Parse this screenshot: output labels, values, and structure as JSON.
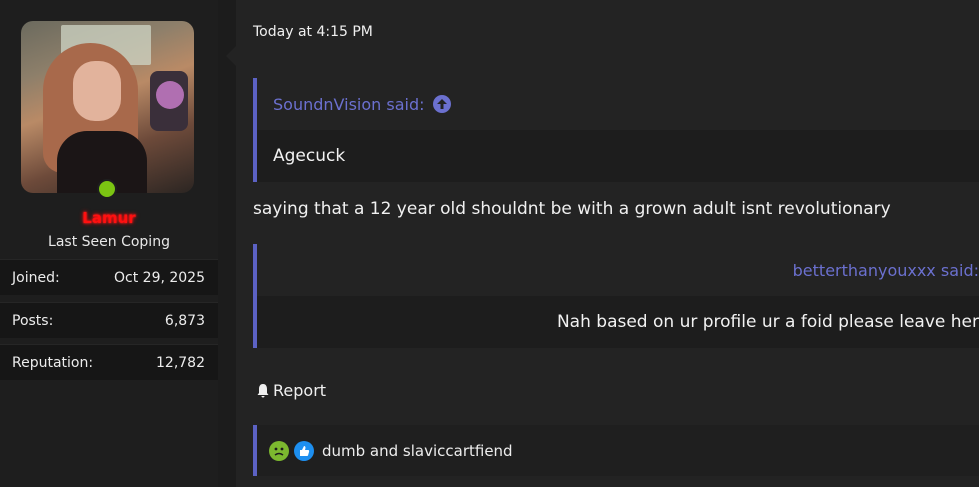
{
  "user": {
    "name": "Lamur",
    "title": "Last Seen Coping",
    "online_color": "#7bc412",
    "name_color": "#ff1010",
    "stats": [
      {
        "label": "Joined:",
        "value": "Oct 29, 2025"
      },
      {
        "label": "Posts:",
        "value": "6,873"
      },
      {
        "label": "Reputation:",
        "value": "12,782"
      }
    ]
  },
  "post": {
    "timestamp": "Today at 4:15 PM",
    "quote1": {
      "author": "SoundnVision said:",
      "text": "Agecuck",
      "icon": "arrow-up-circle-icon"
    },
    "body": "saying that a 12 year old shouldnt be with a grown adult isnt revolutionary",
    "quote2": {
      "author": "betterthanyouxxx said:",
      "text": "Nah based on ur profile ur a foid please leave her"
    },
    "report_label": "Report",
    "report_icon": "bell-icon",
    "reactions_text": "dumb and slaviccartfiend",
    "reaction_icons": [
      "sick-face-icon",
      "thumbs-up-icon"
    ],
    "accent_color": "#5c62c4"
  }
}
